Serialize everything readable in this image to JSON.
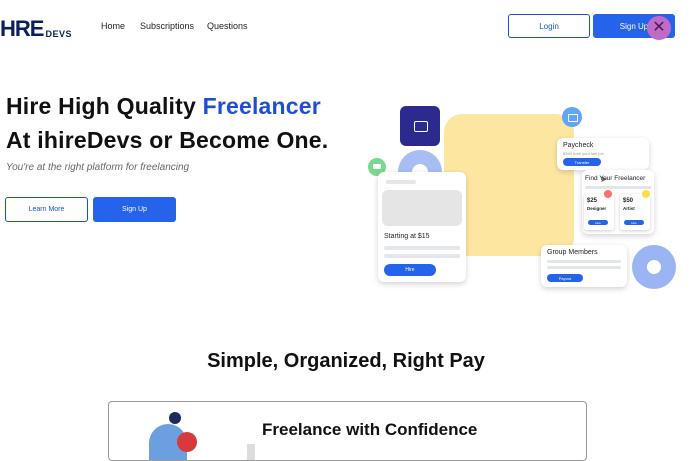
{
  "nav": {
    "logo_main": "HRE",
    "logo_sub": "DEVS",
    "links": [
      "Home",
      "Subscriptions",
      "Questions"
    ],
    "login_label": "Login",
    "signup_label": "Sign Up",
    "close_symbol": "✕"
  },
  "hero": {
    "line1_prefix": "Hire High Quality ",
    "line1_highlight": "Freelancer",
    "line2": "At ihireDevs or Become One.",
    "subtitle": "You're at the right platform for freelancing",
    "learn_more_label": "Learn More",
    "signup_label": "Sign Up"
  },
  "illustration": {
    "job_card": {
      "price_text": "Starting at $15",
      "button_label": "Hire"
    },
    "paycheck_card": {
      "title": "Paycheck",
      "subtitle": "$340 from your last job",
      "button_label": "Transfer"
    },
    "find_card": {
      "title": "Find Your Freelancer",
      "freelancers": [
        {
          "price": "$25",
          "role": "Designer",
          "button_label": "Hire"
        },
        {
          "price": "$50",
          "role": "Artist",
          "button_label": "Hire"
        }
      ]
    },
    "group_card": {
      "title": "Group Members",
      "button_label": "Payout"
    },
    "colors": {
      "primary": "#2563eb",
      "yellow": "#fde7a0",
      "navy": "#2c2a8f",
      "green": "#7bd88f"
    }
  },
  "section": {
    "title": "Simple, Organized, Right Pay",
    "feature_title": "Freelance with Confidence"
  }
}
